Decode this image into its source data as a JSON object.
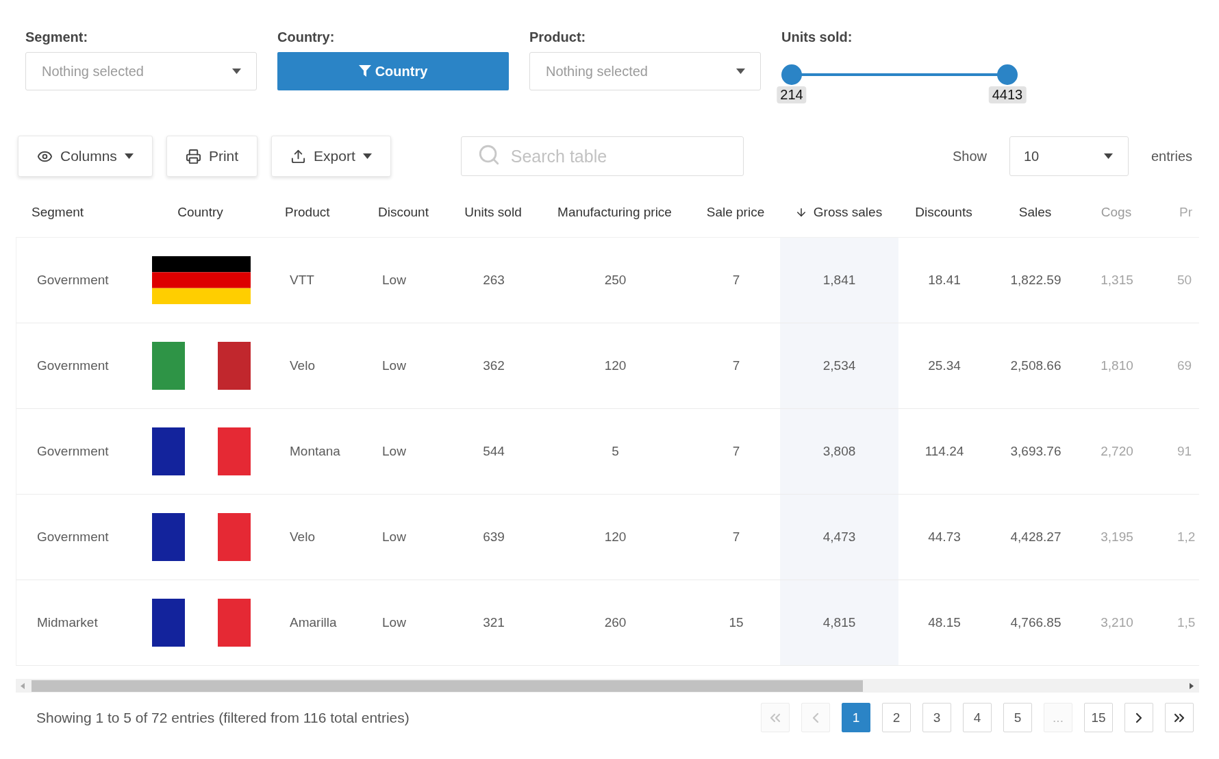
{
  "filters": [
    {
      "kind": "select",
      "label": "Segment:",
      "placeholder": "Nothing selected"
    },
    {
      "kind": "button",
      "label": "Country:",
      "value": "Country"
    },
    {
      "kind": "select",
      "label": "Product:",
      "placeholder": "Nothing selected"
    },
    {
      "kind": "range",
      "label": "Units sold:",
      "thumbs": [
        {
          "level": 0,
          "reading": "214"
        },
        {
          "level": 1,
          "reading": "4413"
        }
      ]
    }
  ],
  "toolbar": {
    "buttons": [
      {
        "kind": "columns",
        "label": "Columns",
        "menu": true
      },
      {
        "kind": "print",
        "label": "Print",
        "menu": false
      },
      {
        "kind": "export",
        "label": "Export",
        "menu": true
      }
    ],
    "search": {
      "placeholder": "Search table"
    },
    "page_size": {
      "label": "Show",
      "value": "10",
      "suffix": "entries"
    }
  },
  "table": {
    "columns": [
      {
        "label": "Segment",
        "sorted": false
      },
      {
        "label": "Country",
        "sorted": false
      },
      {
        "label": "Product",
        "sorted": false
      },
      {
        "label": "Discount",
        "sorted": false
      },
      {
        "label": "Units sold",
        "sorted": false
      },
      {
        "label": "Manufacturing price",
        "sorted": false
      },
      {
        "label": "Sale price",
        "sorted": false
      },
      {
        "label": "Gross sales",
        "sorted": true
      },
      {
        "label": "Discounts",
        "sorted": false
      },
      {
        "label": "Sales",
        "sorted": false
      },
      {
        "label": "Cogs",
        "sorted": false
      },
      {
        "label": "Pr",
        "sorted": false
      }
    ],
    "rows": [
      {
        "segment": "Government",
        "flag": {
          "kind": "horizontal",
          "stripes": [
            {
              "color": "#000000"
            },
            {
              "color": "#dd0000"
            },
            {
              "color": "#ffce00"
            }
          ]
        },
        "product": "VTT",
        "discount": "Low",
        "units_sold": "263",
        "manufacturing_price": "250",
        "sale_price": "7",
        "gross_sales": "1,841",
        "discounts": "18.41",
        "sales": "1,822.59",
        "cogs": "1,315",
        "column_12": "50"
      },
      {
        "segment": "Government",
        "flag": {
          "kind": "vertical",
          "stripes": [
            {
              "color": "#2e9446"
            },
            {
              "color": "#ffffff"
            },
            {
              "color": "#c1272d"
            }
          ]
        },
        "product": "Velo",
        "discount": "Low",
        "units_sold": "362",
        "manufacturing_price": "120",
        "sale_price": "7",
        "gross_sales": "2,534",
        "discounts": "25.34",
        "sales": "2,508.66",
        "cogs": "1,810",
        "column_12": "69"
      },
      {
        "segment": "Government",
        "flag": {
          "kind": "vertical",
          "stripes": [
            {
              "color": "#13239c"
            },
            {
              "color": "#ffffff"
            },
            {
              "color": "#e52934"
            }
          ]
        },
        "product": "Montana",
        "discount": "Low",
        "units_sold": "544",
        "manufacturing_price": "5",
        "sale_price": "7",
        "gross_sales": "3,808",
        "discounts": "114.24",
        "sales": "3,693.76",
        "cogs": "2,720",
        "column_12": "91"
      },
      {
        "segment": "Government",
        "flag": {
          "kind": "vertical",
          "stripes": [
            {
              "color": "#13239c"
            },
            {
              "color": "#ffffff"
            },
            {
              "color": "#e52934"
            }
          ]
        },
        "product": "Velo",
        "discount": "Low",
        "units_sold": "639",
        "manufacturing_price": "120",
        "sale_price": "7",
        "gross_sales": "4,473",
        "discounts": "44.73",
        "sales": "4,428.27",
        "cogs": "3,195",
        "column_12": "1,2"
      },
      {
        "segment": "Midmarket",
        "flag": {
          "kind": "vertical",
          "stripes": [
            {
              "color": "#13239c"
            },
            {
              "color": "#ffffff"
            },
            {
              "color": "#e52934"
            }
          ]
        },
        "product": "Amarilla",
        "discount": "Low",
        "units_sold": "321",
        "manufacturing_price": "260",
        "sale_price": "15",
        "gross_sales": "4,815",
        "discounts": "48.15",
        "sales": "4,766.85",
        "cogs": "3,210",
        "column_12": "1,5"
      }
    ]
  },
  "footer": {
    "info": "Showing 1 to 5 of 72 entries (filtered from 116 total entries)"
  },
  "pagination": {
    "buttons": [
      {
        "kind": "first",
        "selected": false,
        "disabled": true
      },
      {
        "kind": "prev",
        "selected": false,
        "disabled": true
      },
      {
        "kind": "page",
        "label": "1",
        "selected": true,
        "disabled": false
      },
      {
        "kind": "page",
        "label": "2",
        "selected": false,
        "disabled": false
      },
      {
        "kind": "page",
        "label": "3",
        "selected": false,
        "disabled": false
      },
      {
        "kind": "page",
        "label": "4",
        "selected": false,
        "disabled": false
      },
      {
        "kind": "page",
        "label": "5",
        "selected": false,
        "disabled": false
      },
      {
        "kind": "ellipsis",
        "label": "...",
        "selected": false,
        "disabled": true
      },
      {
        "kind": "page",
        "label": "15",
        "selected": false,
        "disabled": false
      },
      {
        "kind": "next",
        "selected": false,
        "disabled": false
      },
      {
        "kind": "last",
        "selected": false,
        "disabled": false
      }
    ]
  }
}
